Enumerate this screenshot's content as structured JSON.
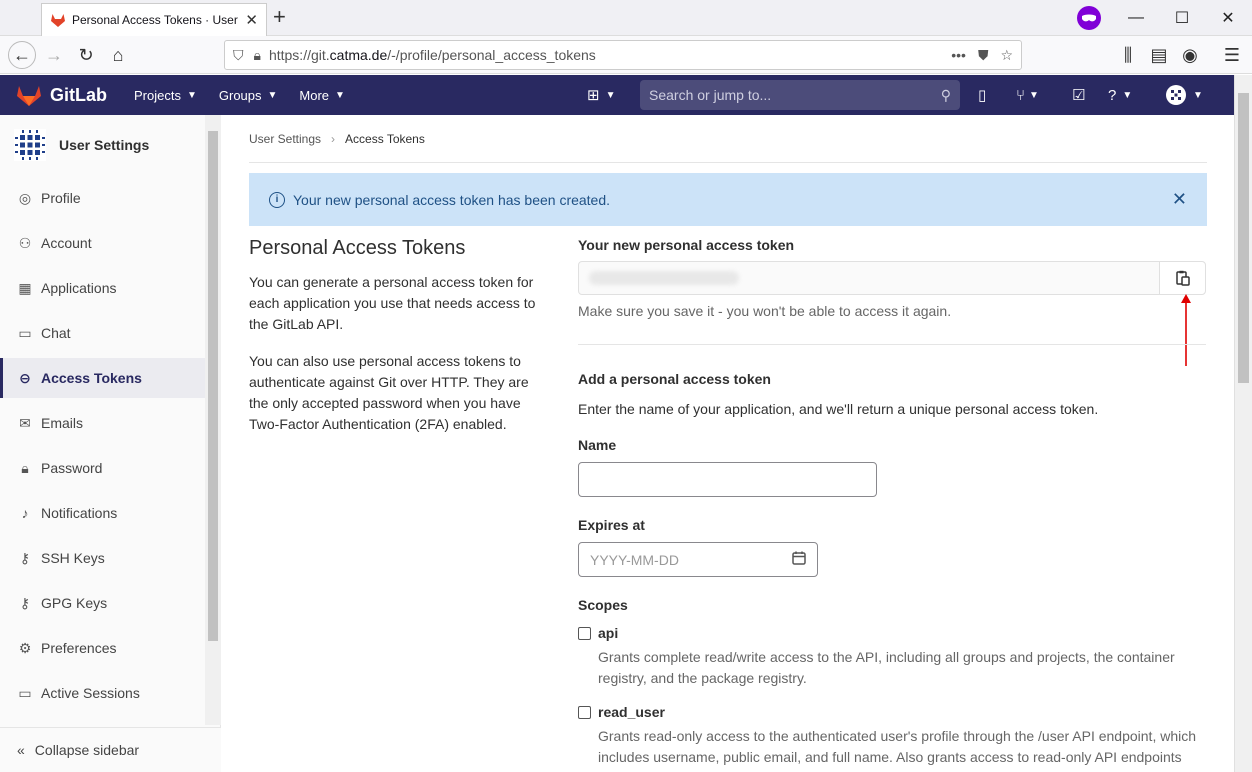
{
  "browser": {
    "tab_title": "Personal Access Tokens · User S",
    "url_prefix": "https://git.",
    "url_domain": "catma.de",
    "url_path": "/-/profile/personal_access_tokens"
  },
  "gitlab": {
    "brand": "GitLab",
    "menu": [
      {
        "label": "Projects"
      },
      {
        "label": "Groups"
      },
      {
        "label": "More"
      }
    ],
    "search_placeholder": "Search or jump to..."
  },
  "sidebar": {
    "title": "User Settings",
    "items": [
      {
        "label": "Profile",
        "icon": "profile-icon"
      },
      {
        "label": "Account",
        "icon": "account-icon"
      },
      {
        "label": "Applications",
        "icon": "applications-icon"
      },
      {
        "label": "Chat",
        "icon": "chat-icon"
      },
      {
        "label": "Access Tokens",
        "icon": "token-icon",
        "active": true
      },
      {
        "label": "Emails",
        "icon": "email-icon"
      },
      {
        "label": "Password",
        "icon": "lock-icon"
      },
      {
        "label": "Notifications",
        "icon": "bell-icon"
      },
      {
        "label": "SSH Keys",
        "icon": "key-icon"
      },
      {
        "label": "GPG Keys",
        "icon": "key-icon"
      },
      {
        "label": "Preferences",
        "icon": "preferences-icon"
      },
      {
        "label": "Active Sessions",
        "icon": "monitor-icon"
      }
    ],
    "collapse_label": "Collapse sidebar"
  },
  "breadcrumb": {
    "parent": "User Settings",
    "current": "Access Tokens"
  },
  "flash": {
    "message": "Your new personal access token has been created."
  },
  "intro": {
    "title": "Personal Access Tokens",
    "p1": "You can generate a personal access token for each application you use that needs access to the GitLab API.",
    "p2": "You can also use personal access tokens to authenticate against Git over HTTP. They are the only accepted password when you have Two-Factor Authentication (2FA) enabled."
  },
  "new_token": {
    "label": "Your new personal access token",
    "help": "Make sure you save it - you won't be able to access it again."
  },
  "form": {
    "title": "Add a personal access token",
    "description": "Enter the name of your application, and we'll return a unique personal access token.",
    "name_label": "Name",
    "expires_label": "Expires at",
    "expires_placeholder": "YYYY-MM-DD",
    "scopes_label": "Scopes",
    "scopes": [
      {
        "name": "api",
        "description": "Grants complete read/write access to the API, including all groups and projects, the container registry, and the package registry."
      },
      {
        "name": "read_user",
        "description": "Grants read-only access to the authenticated user's profile through the /user API endpoint, which includes username, public email, and full name. Also grants access to read-only API endpoints"
      }
    ]
  },
  "colors": {
    "header_bg": "#292961",
    "flash_bg": "#cce3f8",
    "arrow": "#e00000"
  }
}
